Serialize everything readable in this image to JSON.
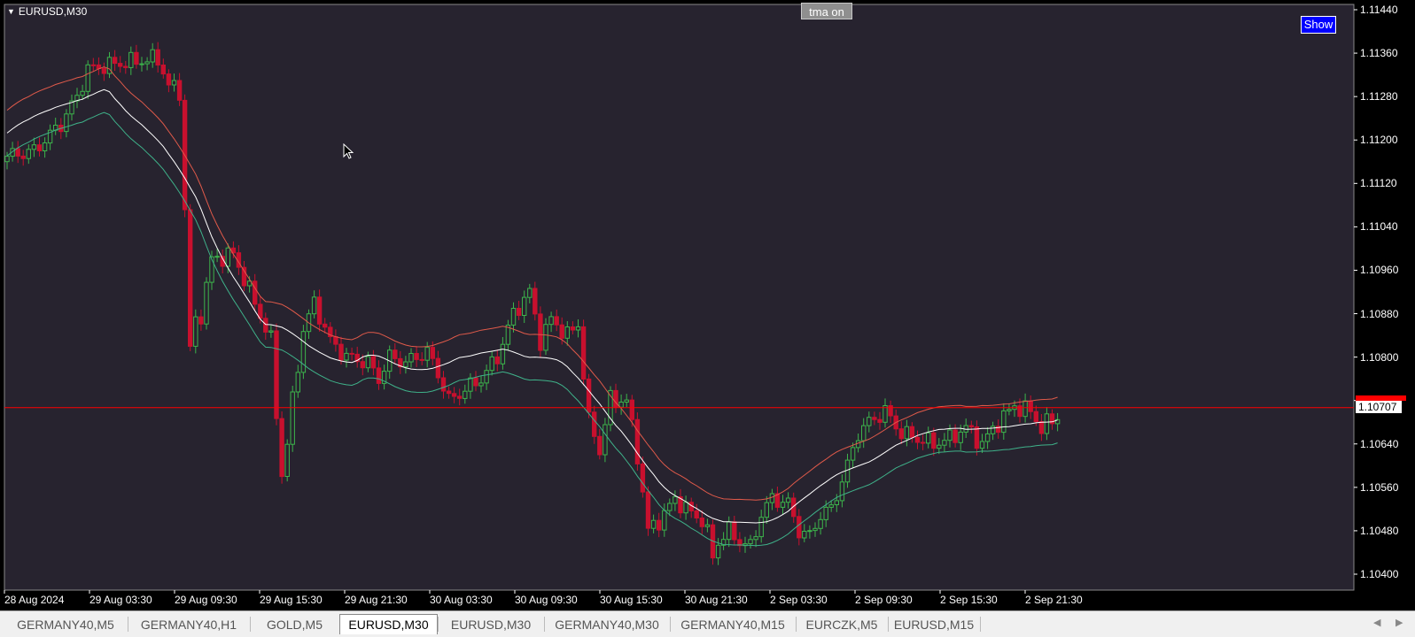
{
  "chart": {
    "title": "EURUSD,M30",
    "tma_label": "tma on",
    "show_label": "Show",
    "current_price": "1.10707",
    "colors": {
      "background": "#000000",
      "plot_background": "#27232f",
      "bull_candle": "#3cb44b",
      "bear_candle": "#c8102e",
      "upper_band": "#e05a4a",
      "middle_band": "#ffffff",
      "lower_band": "#3fb28a",
      "price_line": "#ff0000"
    },
    "price_axis": [
      "1.11440",
      "1.11360",
      "1.11280",
      "1.11200",
      "1.11120",
      "1.11040",
      "1.10960",
      "1.10880",
      "1.10800",
      "1.10720",
      "1.10640",
      "1.10560",
      "1.10480",
      "1.10400"
    ],
    "time_axis": [
      "28 Aug 2024",
      "29 Aug 03:30",
      "29 Aug 09:30",
      "29 Aug 15:30",
      "29 Aug 21:30",
      "30 Aug 03:30",
      "30 Aug 09:30",
      "30 Aug 15:30",
      "30 Aug 21:30",
      "2 Sep 03:30",
      "2 Sep 09:30",
      "2 Sep 15:30",
      "2 Sep 21:30"
    ]
  },
  "tabs": [
    {
      "label": "GERMANY40,M5",
      "active": false
    },
    {
      "label": "GERMANY40,H1",
      "active": false
    },
    {
      "label": "GOLD,M5",
      "active": false
    },
    {
      "label": "EURUSD,M30",
      "active": true
    },
    {
      "label": "EURUSD,M30",
      "active": false
    },
    {
      "label": "GERMANY40,M30",
      "active": false
    },
    {
      "label": "GERMANY40,M15",
      "active": false
    },
    {
      "label": "EURCZK,M5",
      "active": false
    },
    {
      "label": "EURUSD,M15",
      "active": false
    }
  ],
  "scroll": {
    "left_icon": "◀",
    "right_icon": "▶"
  }
}
